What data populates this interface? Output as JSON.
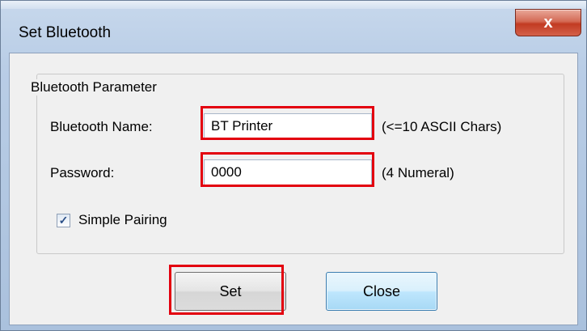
{
  "window": {
    "title": "Set Bluetooth",
    "close_glyph": "x"
  },
  "group": {
    "label": "Bluetooth Parameter"
  },
  "fields": {
    "name_label": "Bluetooth Name:",
    "name_value": "BT Printer",
    "name_hint": "(<=10 ASCII Chars)",
    "password_label": "Password:",
    "password_value": "0000",
    "password_hint": "(4 Numeral)"
  },
  "pairing": {
    "label": "Simple Pairing",
    "checked": true,
    "check_glyph": "✓"
  },
  "buttons": {
    "set_label": "Set",
    "close_label": "Close"
  },
  "colors": {
    "highlight": "#e3000f",
    "client_bg": "#f0f0f0",
    "close_button_red": "#c23b22"
  }
}
